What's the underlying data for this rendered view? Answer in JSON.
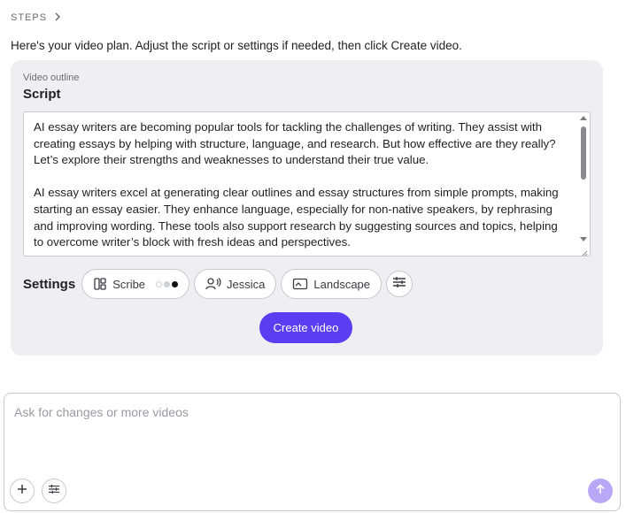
{
  "breadcrumb": {
    "label": "STEPS",
    "chevron_icon": "chevron-right-icon"
  },
  "intro_text": "Here's your video plan. Adjust the script or settings if needed, then click Create video.",
  "outline": {
    "label": "Video outline",
    "script_title": "Script",
    "paragraphs": [
      "AI essay writers are becoming popular tools for tackling the challenges of writing. They assist with creating essays by helping with structure, language, and research. But how effective are they really? Let’s explore their strengths and weaknesses to understand their true value.",
      "AI essay writers excel at generating clear outlines and essay structures from simple prompts, making starting an essay easier. They enhance language, especially for non-native speakers, by rephrasing and improving wording. These tools also support research by suggesting sources and topics, helping to overcome writer’s block with fresh ideas and perspectives."
    ]
  },
  "settings": {
    "label": "Settings",
    "style": {
      "label": "Scribe",
      "icon": "layout-icon",
      "swatches": [
        "#ffffff",
        "#cfd0d6",
        "#111111"
      ]
    },
    "voice": {
      "label": "Jessica",
      "icon": "voice-user-icon"
    },
    "orientation": {
      "label": "Landscape",
      "icon": "landscape-icon"
    },
    "more_icon": "sliders-icon"
  },
  "create_button": {
    "label": "Create video"
  },
  "chat": {
    "placeholder": "Ask for changes or more videos",
    "value": "",
    "add_icon": "plus-icon",
    "options_icon": "sliders-icon",
    "send_icon": "arrow-up-icon"
  },
  "colors": {
    "accent": "#5b3df2",
    "send_disabled": "#b7a9f7",
    "card_bg": "#eeeef3"
  }
}
